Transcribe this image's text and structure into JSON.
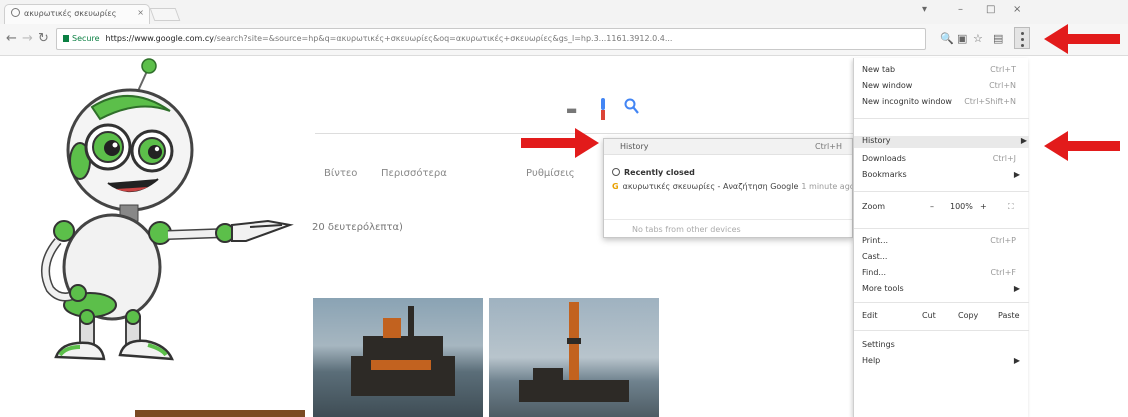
{
  "colors": {
    "arrow": "#e21b1b",
    "secure": "#0b8043",
    "robot_green": "#5cbf4a"
  },
  "browser": {
    "tab": {
      "title": "ακυρωτικές σκευωρίες"
    },
    "window_controls": [
      "▾",
      "–",
      "□",
      "×"
    ],
    "address": {
      "secure_label": "Secure",
      "url_host": "https://www.google.com.cy",
      "url_rest": "/search?site=&source=hp&q=ακυρωτικές+σκευωρίες&oq=ακυρωτικές+σκευωρίες&gs_l=hp.3...1161.3912.0.4..."
    }
  },
  "page": {
    "nav_links": [
      "Βίντεο",
      "Περισσότερα",
      "Ρυθμίσεις"
    ],
    "results_stats": "20 δευτερόλεπτα)",
    "icons": [
      "keyboard-icon",
      "mic-icon",
      "search-icon"
    ]
  },
  "history_popup": {
    "header": "History",
    "shortcut": "Ctrl+H",
    "recently_closed": "Recently closed",
    "entry": "ακυρωτικές σκευωρίες - Αναζήτηση Google",
    "entry_ago": "1 minute ago",
    "footer": "No tabs from other devices"
  },
  "chrome_menu": {
    "new_tab": "New tab",
    "new_tab_sc": "Ctrl+T",
    "new_window": "New window",
    "new_window_sc": "Ctrl+N",
    "incognito": "New incognito window",
    "incognito_sc": "Ctrl+Shift+N",
    "history": "History",
    "downloads": "Downloads",
    "downloads_sc": "Ctrl+J",
    "bookmarks": "Bookmarks",
    "zoom": "Zoom",
    "zoom_minus": "–",
    "zoom_value": "100%",
    "zoom_plus": "+",
    "print": "Print...",
    "print_sc": "Ctrl+P",
    "cast": "Cast...",
    "find": "Find...",
    "find_sc": "Ctrl+F",
    "more_tools": "More tools",
    "edit": "Edit",
    "cut": "Cut",
    "copy": "Copy",
    "paste": "Paste",
    "settings": "Settings",
    "help": "Help"
  }
}
